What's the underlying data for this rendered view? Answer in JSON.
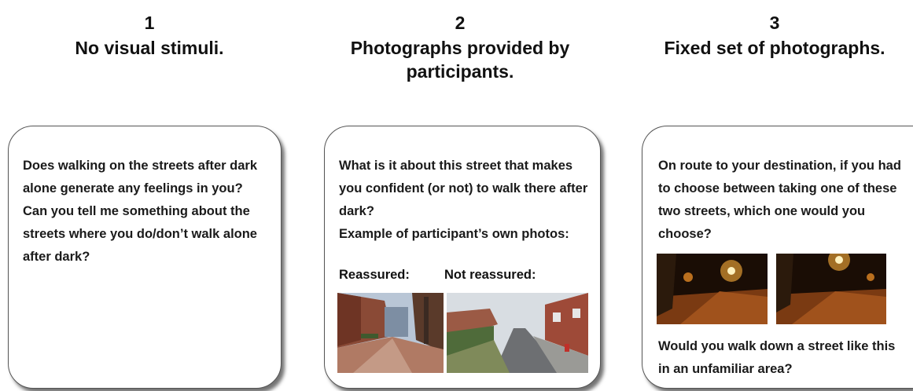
{
  "columns": [
    {
      "number": "1",
      "title": "No visual stimuli.",
      "card_text": [
        "Does walking on the streets after dark alone generate any feelings in you?",
        "Can you tell me something about the streets where you do/don’t walk alone after dark?"
      ]
    },
    {
      "number": "2",
      "title": "Photographs provided by participants.",
      "card_text": [
        "What is it about this street that makes you confident (or not) to walk there after dark?",
        "Example of participant’s own photos:"
      ],
      "photo_labels": [
        "Reassured:",
        "Not reassured:"
      ]
    },
    {
      "number": "3",
      "title": "Fixed set of photographs.",
      "card_text_top": "On route to your destination, if you had to choose between taking one of these two streets, which one would you choose?",
      "card_text_bottom": "Would you walk down a street like this in an unfamiliar area?"
    }
  ]
}
